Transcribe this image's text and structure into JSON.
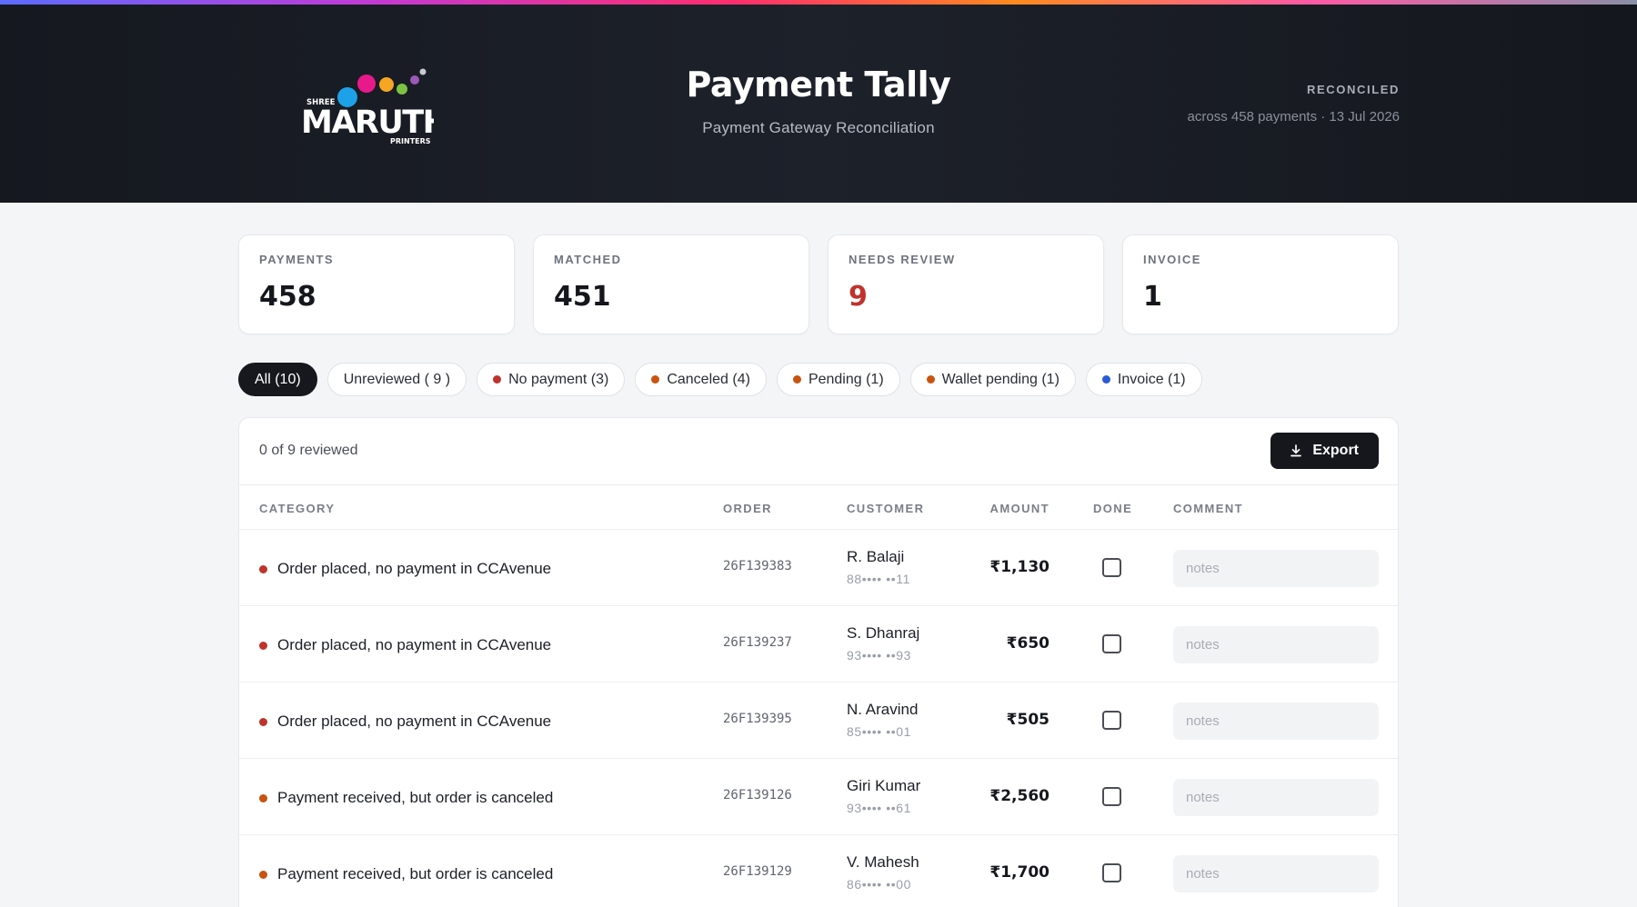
{
  "header": {
    "logo_text": {
      "prefix": "SHREE",
      "name": "MARUTHI",
      "suffix": "PRINTERS"
    },
    "title": "Payment Tally",
    "subtitle": "Payment Gateway Reconciliation",
    "status_label": "RECONCILED",
    "status_meta": "across 458 payments · 13 Jul 2026"
  },
  "stats": [
    {
      "label": "PAYMENTS",
      "value": "458"
    },
    {
      "label": "MATCHED",
      "value": "451"
    },
    {
      "label": "NEEDS REVIEW",
      "value": "9",
      "alert": true
    },
    {
      "label": "INVOICE",
      "value": "1"
    }
  ],
  "filters": [
    {
      "label": "All (10)",
      "active": true
    },
    {
      "label": "Unreviewed ( 9 )"
    },
    {
      "label": "No payment (3)",
      "dot": "#c0322c"
    },
    {
      "label": "Canceled (4)",
      "dot": "#c8530f"
    },
    {
      "label": "Pending (1)",
      "dot": "#c8530f"
    },
    {
      "label": "Wallet pending (1)",
      "dot": "#c8530f"
    },
    {
      "label": "Invoice (1)",
      "dot": "#2a5bd7"
    }
  ],
  "table": {
    "reviewed_text": "0 of 9 reviewed",
    "export_label": "Export",
    "columns": {
      "category": "CATEGORY",
      "order": "ORDER",
      "customer": "CUSTOMER",
      "amount": "AMOUNT",
      "done": "DONE",
      "comment": "COMMENT"
    },
    "note_placeholder": "notes",
    "rows": [
      {
        "dot": "#c0322c",
        "category": "Order placed, no payment in CCAvenue",
        "order": "26F139383",
        "name": "R. Balaji",
        "phone": "88•••• ••11",
        "amount": "₹1,130"
      },
      {
        "dot": "#c0322c",
        "category": "Order placed, no payment in CCAvenue",
        "order": "26F139237",
        "name": "S. Dhanraj",
        "phone": "93•••• ••93",
        "amount": "₹650"
      },
      {
        "dot": "#c0322c",
        "category": "Order placed, no payment in CCAvenue",
        "order": "26F139395",
        "name": "N. Aravind",
        "phone": "85•••• ••01",
        "amount": "₹505"
      },
      {
        "dot": "#c8530f",
        "category": "Payment received, but order is canceled",
        "order": "26F139126",
        "name": "Giri Kumar",
        "phone": "93•••• ••61",
        "amount": "₹2,560"
      },
      {
        "dot": "#c8530f",
        "category": "Payment received, but order is canceled",
        "order": "26F139129",
        "name": "V. Mahesh",
        "phone": "86•••• ••00",
        "amount": "₹1,700"
      }
    ]
  },
  "colors": {
    "accent_dark": "#15171c",
    "alert_red": "#c0322c",
    "warn_orange": "#c8530f",
    "info_blue": "#2a5bd7"
  }
}
